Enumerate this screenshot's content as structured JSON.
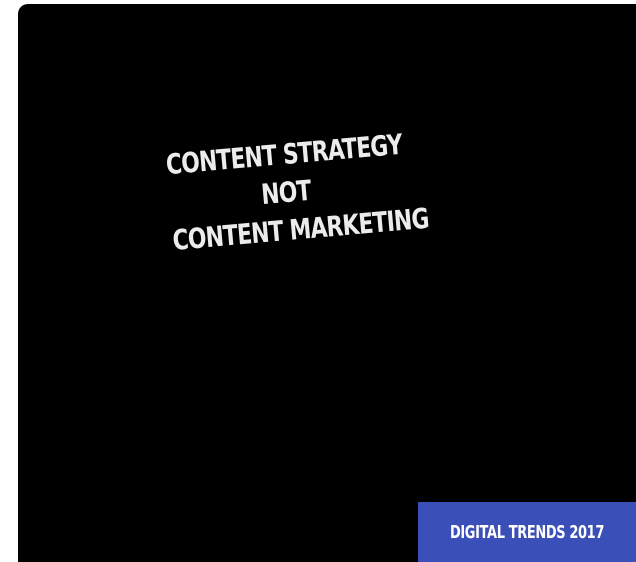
{
  "headline": {
    "line1": "CONTENT STRATEGY",
    "line2": "NOT",
    "line3": "CONTENT MARKETING"
  },
  "badge": {
    "label": "DIGITAL TRENDS 2017",
    "color": "#3b4fb8"
  },
  "colors": {
    "background": "#000000",
    "text": "#ececec"
  }
}
